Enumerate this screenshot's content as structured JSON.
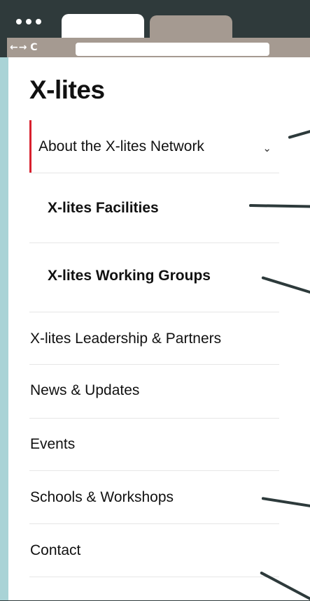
{
  "browser": {
    "nav_icons": "←→ C",
    "address": ""
  },
  "site": {
    "brand": "X-lites"
  },
  "menu": {
    "items": [
      {
        "label": "About the X-lites Network",
        "chevron": "⌄"
      },
      {
        "label": "X-lites Facilities"
      },
      {
        "label": "X-lites Working Groups"
      },
      {
        "label": "X-lites Leadership & Partners"
      },
      {
        "label": "News & Updates"
      },
      {
        "label": "Events"
      },
      {
        "label": "Schools & Workshops"
      },
      {
        "label": "Contact"
      }
    ]
  },
  "colors": {
    "accent": "#d8202e",
    "chrome_dark": "#2f3a3b",
    "chrome_tab": "#a59a91",
    "teal": "#a9d3d6"
  }
}
